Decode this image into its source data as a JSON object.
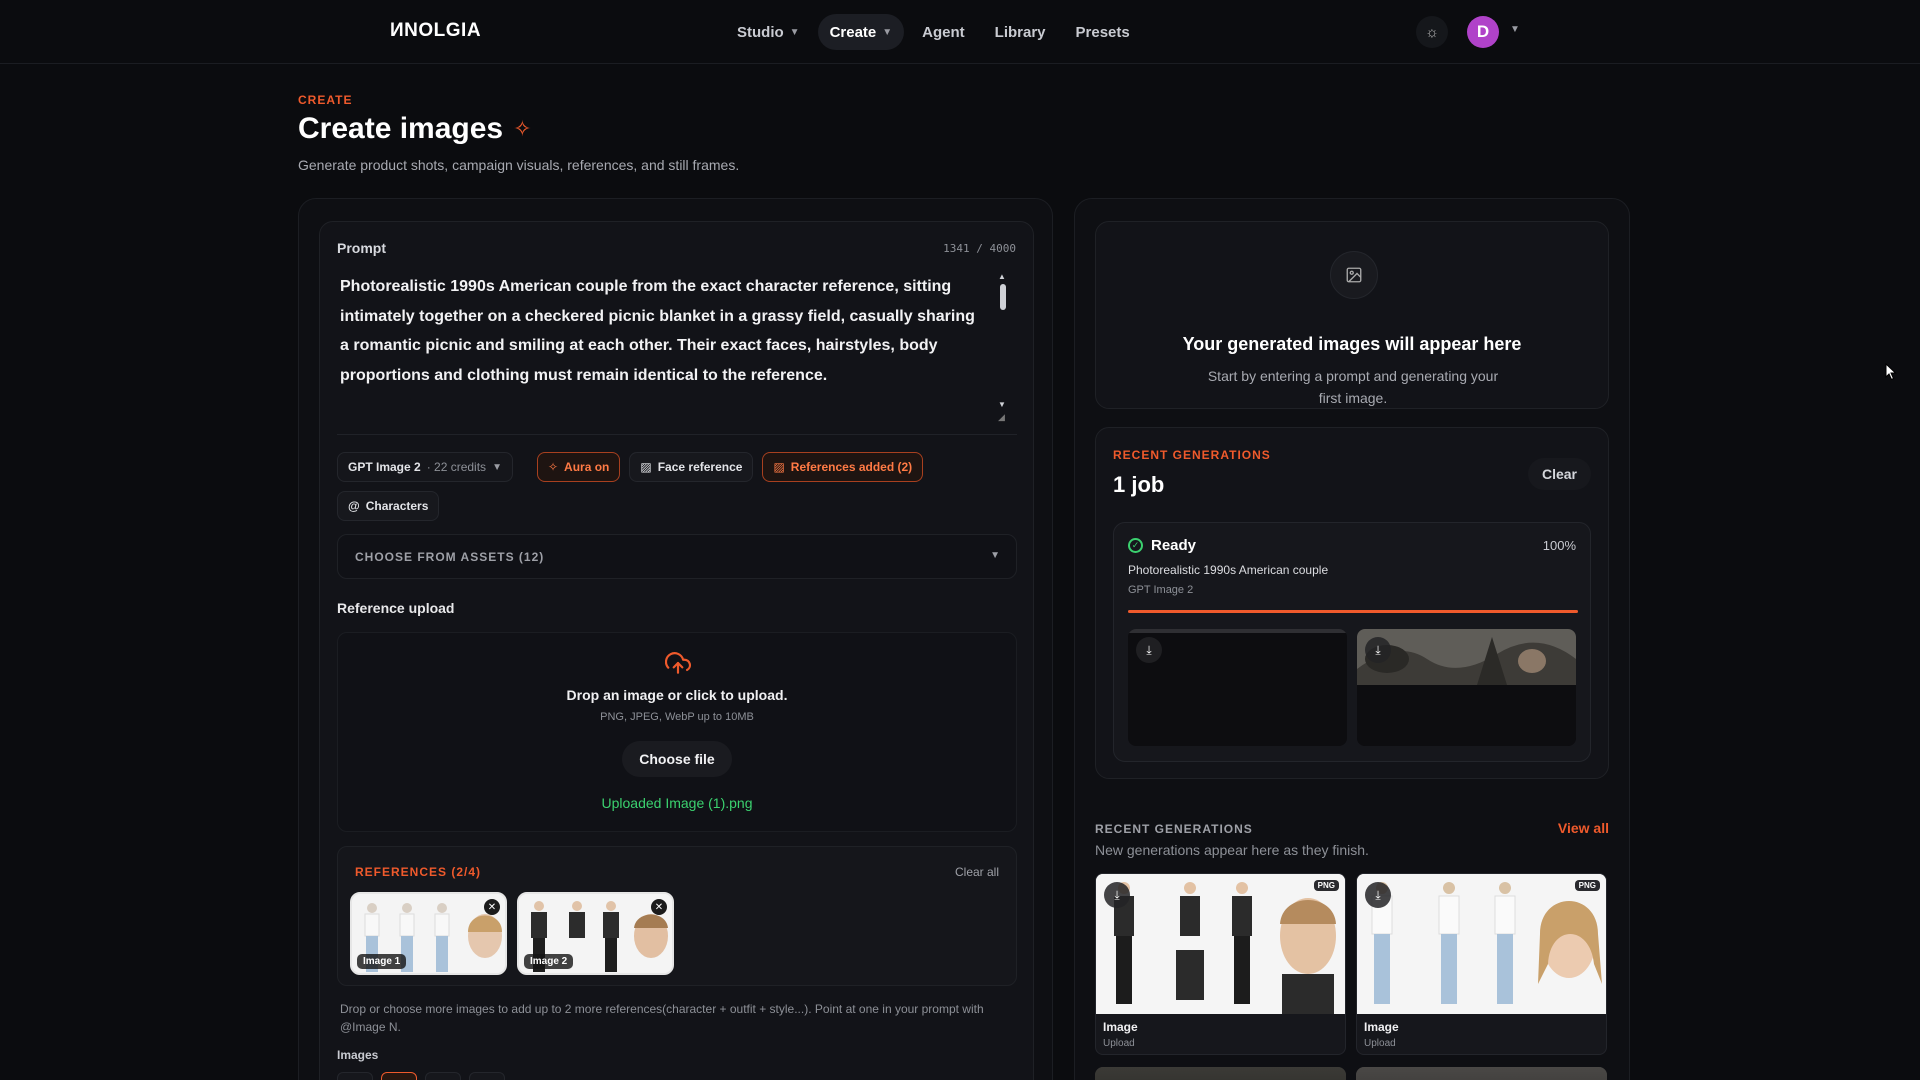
{
  "nav": {
    "logo": "ИNOLGIA",
    "items": [
      {
        "label": "Studio",
        "has_menu": true,
        "active": false
      },
      {
        "label": "Create",
        "has_menu": true,
        "active": true
      },
      {
        "label": "Agent",
        "has_menu": false,
        "active": false
      },
      {
        "label": "Library",
        "has_menu": false,
        "active": false
      },
      {
        "label": "Presets",
        "has_menu": false,
        "active": false
      }
    ],
    "theme_icon": "sun-icon",
    "avatar_initial": "D",
    "avatar_color": "#b042c9"
  },
  "header": {
    "eyebrow": "CREATE",
    "title": "Create images",
    "subtitle": "Generate product shots, campaign visuals, references, and still frames."
  },
  "prompt": {
    "label": "Prompt",
    "counter": "1341 / 4000",
    "text": "Photorealistic 1990s American couple from the exact character reference, sitting intimately together on a checkered picnic blanket in a grassy field, casually sharing a romantic picnic and smiling at each other. Their exact faces, hairstyles, body proportions and clothing must remain identical to the reference."
  },
  "options": {
    "model": "GPT Image 2",
    "credits": "· 22 credits",
    "aura": "Aura on",
    "face_reference": "Face reference",
    "references_added": "References added (2)",
    "characters": "Characters"
  },
  "assets": {
    "label": "CHOOSE FROM ASSETS (12)"
  },
  "upload": {
    "title": "Reference upload",
    "drop_title": "Drop an image or click to upload.",
    "drop_sub": "PNG, JPEG, WebP up to 10MB",
    "choose_button": "Choose file",
    "uploaded": "Uploaded Image (1).png"
  },
  "references": {
    "title": "REFERENCES (2/4)",
    "clear": "Clear all",
    "items": [
      {
        "label": "Image 1"
      },
      {
        "label": "Image 2"
      }
    ],
    "help": "Drop or choose more images to add up to 2 more references(character + outfit + style...). Point at one in your prompt with @Image N.",
    "images_label": "Images"
  },
  "empty_state": {
    "title": "Your generated images will appear here",
    "subtitle": "Start by entering a prompt and generating your first image."
  },
  "jobs": {
    "eyebrow": "RECENT GENERATIONS",
    "count": "1 job",
    "clear": "Clear",
    "item": {
      "status": "Ready",
      "percent": "100%",
      "progress": 1.0,
      "description": "Photorealistic 1990s American couple",
      "model": "GPT Image 2"
    }
  },
  "recent": {
    "title": "RECENT GENERATIONS",
    "view_all": "View all",
    "subtitle": "New generations appear here as they finish.",
    "items": [
      {
        "name": "Image",
        "source": "Upload",
        "badge": "PNG"
      },
      {
        "name": "Image",
        "source": "Upload",
        "badge": "PNG"
      }
    ]
  },
  "colors": {
    "accent": "#ef5a2c",
    "success": "#3bd16f",
    "background": "#0b0c0f"
  }
}
